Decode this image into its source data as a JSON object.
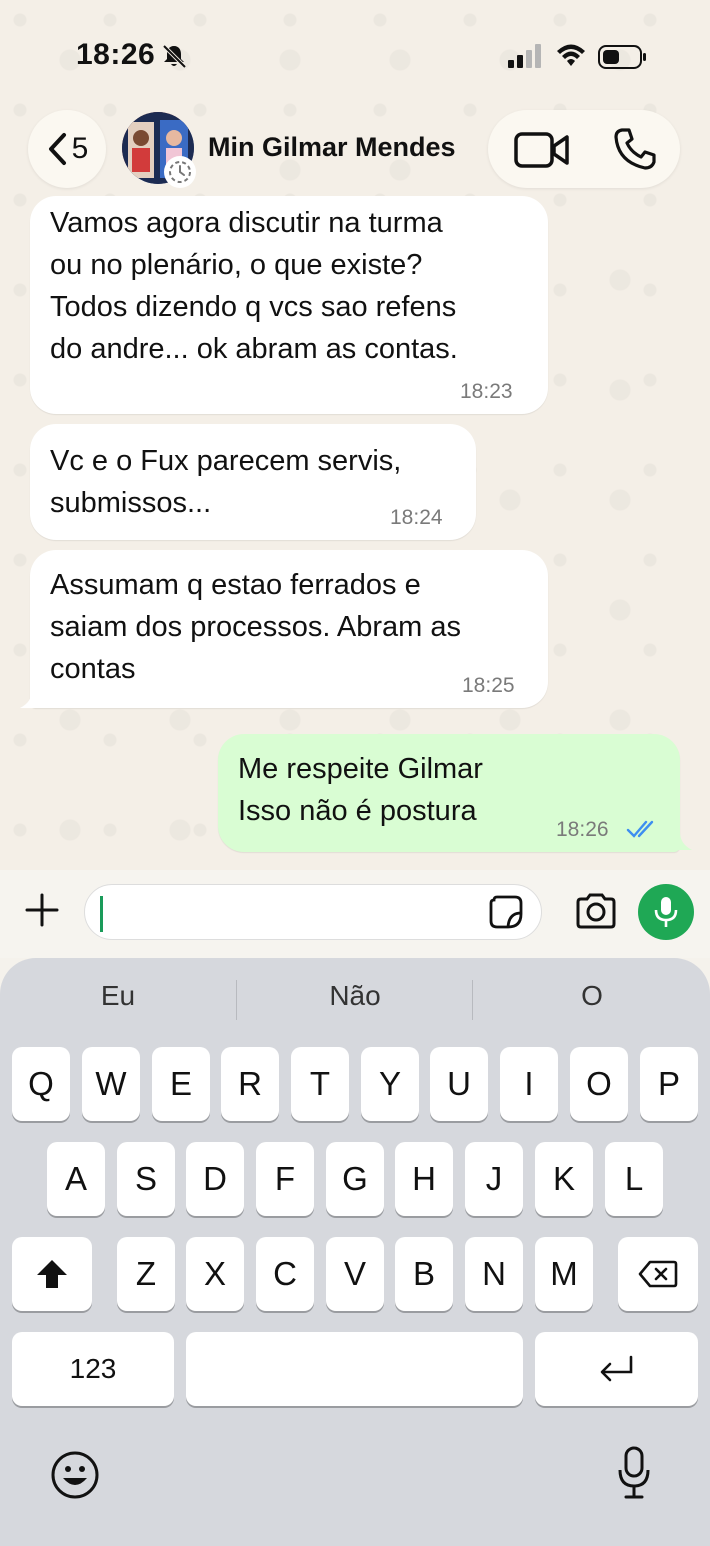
{
  "status_bar": {
    "time": "18:26"
  },
  "header": {
    "back_count": "5",
    "contact_name": "Min Gilmar Mendes"
  },
  "messages": [
    {
      "direction": "in",
      "text": "Vamos agora discutir na turma\nou no plenário, o que existe?\nTodos dizendo q vcs sao refens\ndo andre... ok abram as contas.",
      "time": "18:23"
    },
    {
      "direction": "in",
      "text": "Vc e o Fux parecem servis,\nsubmissos...",
      "time": "18:24"
    },
    {
      "direction": "in",
      "text": "Assumam q estao ferrados e\nsaiam dos processos. Abram as\ncontas",
      "time": "18:25"
    },
    {
      "direction": "out",
      "text": "Me respeite Gilmar\nIsso não é postura",
      "time": "18:26",
      "status": "read"
    }
  ],
  "input": {
    "placeholder": ""
  },
  "keyboard": {
    "suggestions": [
      "Eu",
      "Não",
      "O"
    ],
    "row1": [
      "Q",
      "W",
      "E",
      "R",
      "T",
      "Y",
      "U",
      "I",
      "O",
      "P"
    ],
    "row2": [
      "A",
      "S",
      "D",
      "F",
      "G",
      "H",
      "J",
      "K",
      "L"
    ],
    "row3": [
      "Z",
      "X",
      "C",
      "V",
      "B",
      "N",
      "M"
    ],
    "numbers_key": "123"
  },
  "colors": {
    "outgoing_bubble": "#d9fdd3",
    "incoming_bubble": "#ffffff",
    "accent_green": "#1fa855",
    "read_ticks": "#3d8ef0"
  }
}
